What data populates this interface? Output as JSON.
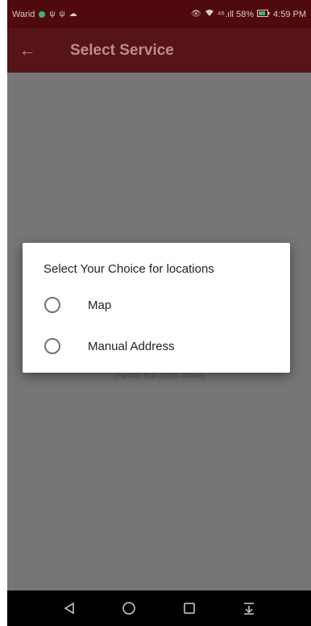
{
  "status_bar": {
    "carrier": "Warid",
    "right_text": "⁴⁶.ıll 58%",
    "time": "4:59 PM",
    "icons": [
      "usb-icon",
      "usb-icon",
      "cloud-icon",
      "eye-icon",
      "wifi-icon",
      "battery-icon"
    ]
  },
  "app_bar": {
    "title": "Select Service",
    "back_icon": "arrow-left-icon"
  },
  "background_hint": "(Faster but costs more)",
  "dialog": {
    "title": "Select Your Choice for locations",
    "options": [
      {
        "label": "Map",
        "selected": false
      },
      {
        "label": "Manual Address",
        "selected": false
      }
    ]
  },
  "nav_bar": {
    "buttons": [
      "back-triangle-icon",
      "home-circle-icon",
      "recents-square-icon",
      "notifications-pull-icon"
    ]
  },
  "colors": {
    "status_bar": "#500a0d",
    "app_bar": "#561417",
    "scrim_bg": "#767676",
    "dialog_bg": "#ffffff",
    "text_dark": "#222222"
  }
}
